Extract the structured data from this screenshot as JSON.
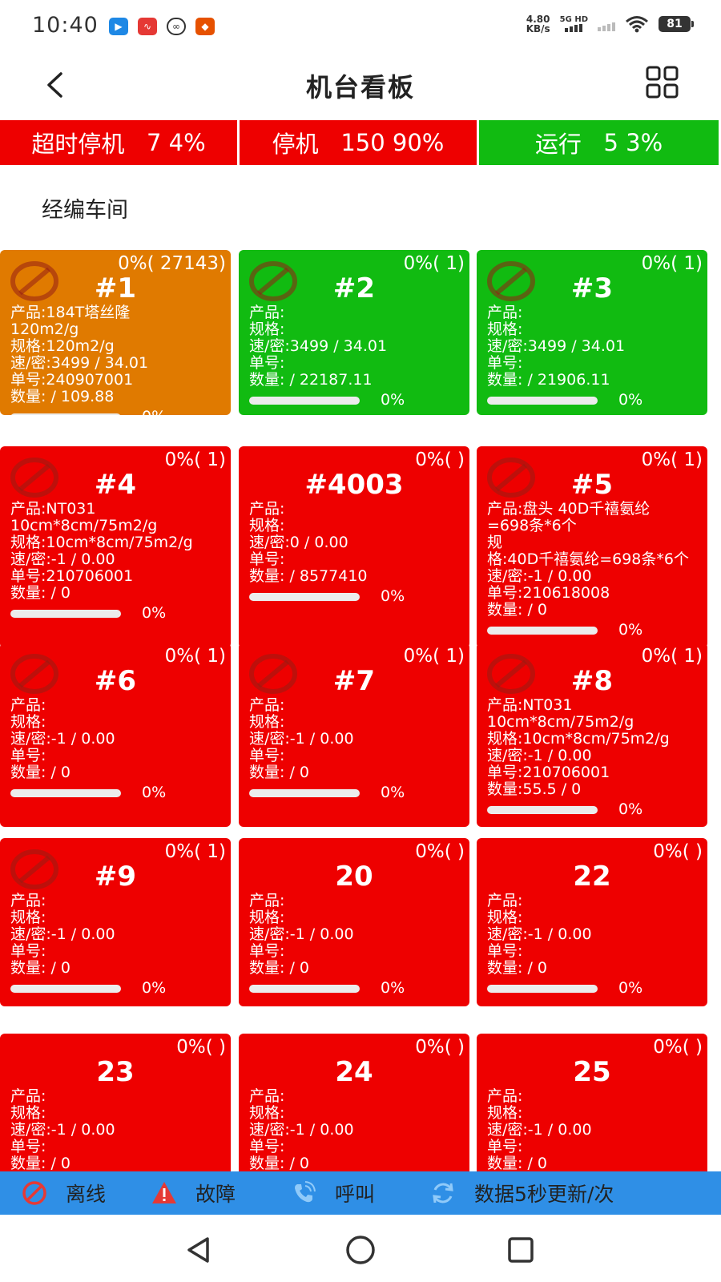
{
  "status_bar": {
    "time": "10:40",
    "net_speed_value": "4.80",
    "net_speed_unit": "KB/s",
    "network_type": "5G HD",
    "battery": "81"
  },
  "header": {
    "title": "机台看板",
    "back_icon": "chevron-left-icon",
    "menu_icon": "grid-icon"
  },
  "summary": [
    {
      "label": "超时停机",
      "count": "7",
      "percent": "4%",
      "color": "#ee0000"
    },
    {
      "label": "停机",
      "count": "150",
      "percent": "90%",
      "color": "#ee0000"
    },
    {
      "label": "运行",
      "count": "5",
      "percent": "3%",
      "color": "#11bb11"
    }
  ],
  "workshop": "经编车间",
  "colors": {
    "orange": "#e07a00",
    "green": "#11bb11",
    "red": "#ee0000",
    "legend_bg": "#2f8fe6"
  },
  "machines": [
    {
      "pct": "0%( 27143)",
      "name": "#1",
      "status": "orange",
      "banned": true,
      "lines": [
        "产品:184T塔丝隆",
        "120m2/g",
        "规格:120m2/g",
        "速/密:3499 / 34.01",
        "单号:240907001",
        "数量: / 109.88"
      ],
      "progress": "0%",
      "progress_value": 0
    },
    {
      "pct": "0%( 1)",
      "name": "#2",
      "status": "green",
      "banned": true,
      "lines": [
        "产品:",
        "规格:",
        "速/密:3499 / 34.01",
        "单号:",
        "数量: / 22187.11"
      ],
      "progress": "0%",
      "progress_value": 0
    },
    {
      "pct": "0%( 1)",
      "name": "#3",
      "status": "green",
      "banned": true,
      "lines": [
        "产品:",
        "规格:",
        "速/密:3499 / 34.01",
        "单号:",
        "数量: / 21906.11"
      ],
      "progress": "0%",
      "progress_value": 0
    },
    {
      "pct": "0%( 1)",
      "name": "#4",
      "status": "red",
      "banned": true,
      "lines": [
        "产品:NT031",
        "10cm*8cm/75m2/g",
        "规格:10cm*8cm/75m2/g",
        "速/密:-1 / 0.00",
        "单号:210706001",
        "数量: / 0"
      ],
      "progress": "0%",
      "progress_value": 0
    },
    {
      "pct": "0%( )",
      "name": "#4003",
      "status": "red",
      "banned": false,
      "lines": [
        "产品:",
        "规格:",
        "速/密:0 / 0.00",
        "单号:",
        "数量: / 8577410"
      ],
      "progress": "0%",
      "progress_value": 0
    },
    {
      "pct": "0%( 1)",
      "name": "#5",
      "status": "red",
      "banned": true,
      "lines": [
        "产品:盘头 40D千禧氨纶",
        "=698条*6个",
        "规",
        "格:40D千禧氨纶=698条*6个",
        "速/密:-1 / 0.00",
        "单号:210618008",
        "数量: / 0"
      ],
      "progress": "0%",
      "progress_value": 0
    },
    {
      "pct": "0%( 1)",
      "name": "#6",
      "status": "red",
      "banned": true,
      "lines": [
        "产品:",
        "规格:",
        "速/密:-1 / 0.00",
        "单号:",
        "数量: / 0"
      ],
      "progress": "0%",
      "progress_value": 0
    },
    {
      "pct": "0%( 1)",
      "name": "#7",
      "status": "red",
      "banned": true,
      "lines": [
        "产品:",
        "规格:",
        "速/密:-1 / 0.00",
        "单号:",
        "数量: / 0"
      ],
      "progress": "0%",
      "progress_value": 0
    },
    {
      "pct": "0%( 1)",
      "name": "#8",
      "status": "red",
      "banned": true,
      "lines": [
        "产品:NT031",
        "10cm*8cm/75m2/g",
        "规格:10cm*8cm/75m2/g",
        "速/密:-1 / 0.00",
        "单号:210706001",
        "数量:55.5 / 0"
      ],
      "progress": "0%",
      "progress_value": 0
    },
    {
      "pct": "0%( 1)",
      "name": "#9",
      "status": "red",
      "banned": true,
      "lines": [
        "产品:",
        "规格:",
        "速/密:-1 / 0.00",
        "单号:",
        "数量: / 0"
      ],
      "progress": "0%",
      "progress_value": 0
    },
    {
      "pct": "0%( )",
      "name": "20",
      "status": "red",
      "banned": false,
      "lines": [
        "产品:",
        "规格:",
        "速/密:-1 / 0.00",
        "单号:",
        "数量: / 0"
      ],
      "progress": "0%",
      "progress_value": 0
    },
    {
      "pct": "0%( )",
      "name": "22",
      "status": "red",
      "banned": false,
      "lines": [
        "产品:",
        "规格:",
        "速/密:-1 / 0.00",
        "单号:",
        "数量: / 0"
      ],
      "progress": "0%",
      "progress_value": 0
    },
    {
      "pct": "0%( )",
      "name": "23",
      "status": "red",
      "banned": false,
      "lines": [
        "产品:",
        "规格:",
        "速/密:-1 / 0.00",
        "单号:",
        "数量: / 0"
      ],
      "progress": "",
      "progress_value": 0
    },
    {
      "pct": "0%( )",
      "name": "24",
      "status": "red",
      "banned": false,
      "lines": [
        "产品:",
        "规格:",
        "速/密:-1 / 0.00",
        "单号:",
        "数量: / 0"
      ],
      "progress": "",
      "progress_value": 0
    },
    {
      "pct": "0%( )",
      "name": "25",
      "status": "red",
      "banned": false,
      "lines": [
        "产品:",
        "规格:",
        "速/密:-1 / 0.00",
        "单号:",
        "数量: / 0"
      ],
      "progress": "",
      "progress_value": 0
    }
  ],
  "legend": [
    {
      "icon": "offline-icon",
      "label": "离线"
    },
    {
      "icon": "warning-icon",
      "label": "故障"
    },
    {
      "icon": "phone-call-icon",
      "label": "呼叫"
    },
    {
      "icon": "refresh-icon",
      "label": "数据5秒更新/次"
    }
  ],
  "nav": {
    "back_icon": "nav-back-icon",
    "home_icon": "nav-home-icon",
    "recents_icon": "nav-recents-icon"
  }
}
